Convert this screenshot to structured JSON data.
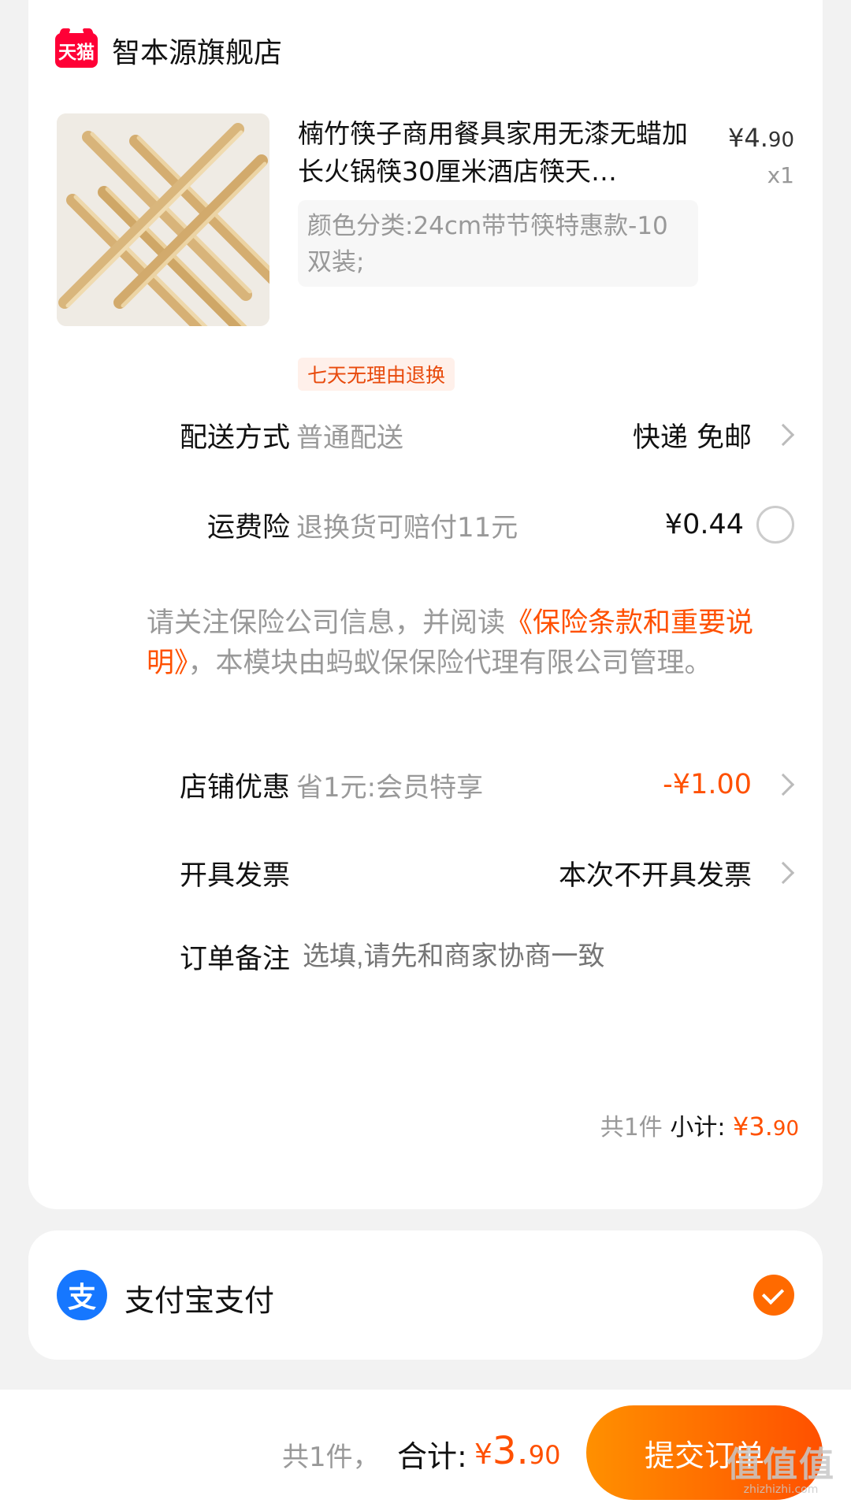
{
  "store": {
    "badge": "天猫",
    "name": "智本源旗舰店"
  },
  "product": {
    "title": "楠竹筷子商用餐具家用无漆无蜡加长火锅筷30厘米酒店筷天…",
    "price_symbol": "¥",
    "price_int": "4.",
    "price_dec": "90",
    "quantity": "x1",
    "sku": "颜色分类:24cm带节筷特惠款-10双装;",
    "tag": "七天无理由退换"
  },
  "delivery": {
    "label": "配送方式",
    "desc": "普通配送",
    "value": "快递 免邮"
  },
  "insurance": {
    "label": "运费险",
    "desc": "退换货可赔付11元",
    "value": "¥0.44",
    "note_pre": "请关注保险公司信息，并阅读",
    "note_link": "《保险条款和重要说明》",
    "note_post": "，本模块由蚂蚁保保险代理有限公司管理。"
  },
  "discount": {
    "label": "店铺优惠",
    "desc": "省1元:会员特享",
    "value": "-¥1.00"
  },
  "invoice": {
    "label": "开具发票",
    "value": "本次不开具发票"
  },
  "remark": {
    "label": "订单备注",
    "placeholder": "选填,请先和商家协商一致"
  },
  "subtotal": {
    "count": "共1件",
    "label": "小计:",
    "symbol": "¥",
    "int": "3.",
    "dec": "90"
  },
  "payment": {
    "icon_char": "支",
    "label": "支付宝支付",
    "selected": true
  },
  "footer": {
    "count": "共1件，",
    "total_label": "合计:",
    "symbol": "¥",
    "int": "3.",
    "dec": "90",
    "submit": "提交订单"
  },
  "watermark": {
    "big": "值值值",
    "small": "zhizhizhi.com"
  },
  "colors": {
    "accent": "#ff5000",
    "tmall": "#ff0036",
    "alipay": "#1677ff"
  }
}
